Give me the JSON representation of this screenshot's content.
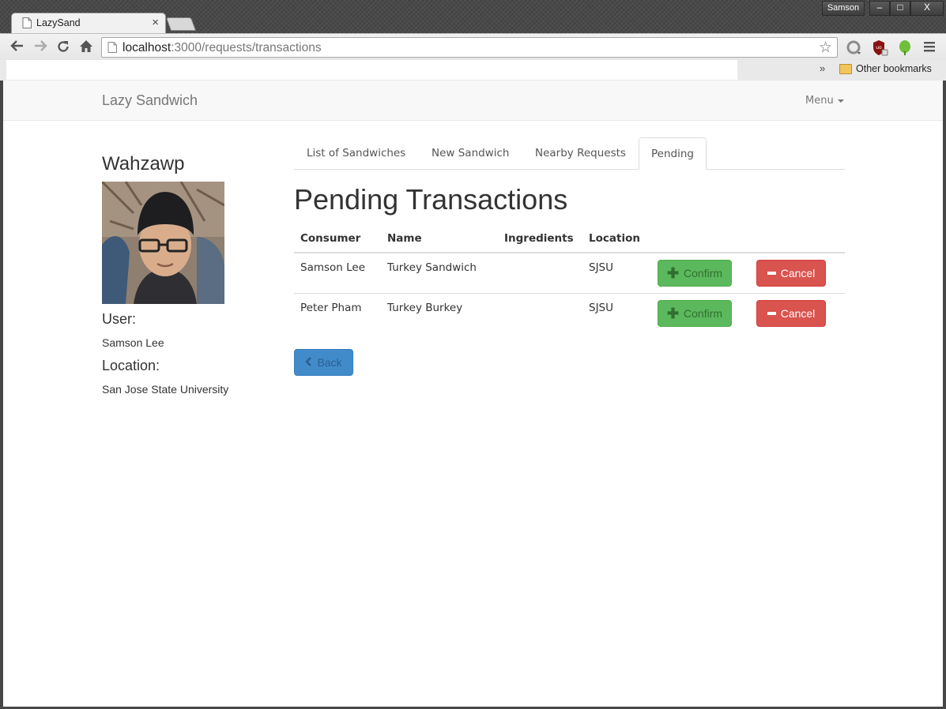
{
  "browser": {
    "tab_title": "LazySand",
    "tab_close": "×",
    "user_badge": "Samson",
    "win_minimize": "–",
    "win_maximize": "□",
    "win_close": "X",
    "url_host": "localhost",
    "url_path": ":3000/requests/transactions",
    "other_bookmarks": "Other bookmarks",
    "bookmark_chevron": "»"
  },
  "navbar": {
    "brand": "Lazy Sandwich",
    "menu_label": "Menu"
  },
  "profile": {
    "name": "Wahzawp",
    "user_label": "User:",
    "user_value": "Samson Lee",
    "location_label": "Location:",
    "location_value": "San Jose State University"
  },
  "tabs": [
    {
      "label": "List of Sandwiches",
      "active": false
    },
    {
      "label": "New Sandwich",
      "active": false
    },
    {
      "label": "Nearby Requests",
      "active": false
    },
    {
      "label": "Pending",
      "active": true
    }
  ],
  "main": {
    "heading": "Pending Transactions",
    "back_label": "Back"
  },
  "table": {
    "columns": [
      "Consumer",
      "Name",
      "Ingredients",
      "Location"
    ],
    "rows": [
      {
        "consumer": "Samson Lee",
        "name": "Turkey Sandwich",
        "ingredients": "",
        "location": "SJSU",
        "confirm": "Confirm",
        "cancel": "Cancel"
      },
      {
        "consumer": "Peter Pham",
        "name": "Turkey Burkey",
        "ingredients": "",
        "location": "SJSU",
        "confirm": "Confirm",
        "cancel": "Cancel"
      }
    ]
  },
  "colors": {
    "success": "#5cb85c",
    "danger": "#d9534f",
    "primary": "#428bca"
  }
}
